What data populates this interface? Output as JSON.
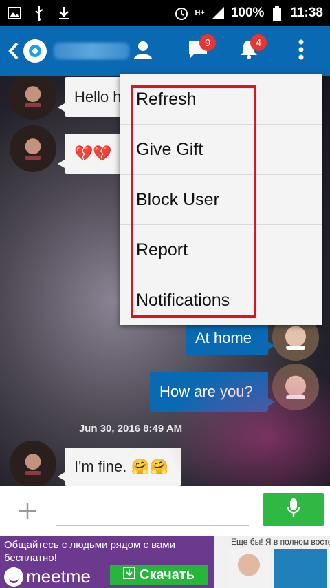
{
  "status_bar": {
    "network": "H+",
    "battery": "100%",
    "time": "11:38"
  },
  "app_bar": {
    "icons": [
      "back-arrow-icon",
      "app-logo-icon",
      "profile-icon",
      "chat-icon",
      "bell-icon",
      "overflow-menu-icon"
    ],
    "chat_badge": "9",
    "notification_badge": "4"
  },
  "messages": {
    "m1": "Hello h",
    "m2": "💔💔",
    "m3": "At home",
    "m4": "How are you?",
    "date": "Jun 30, 2016 8:49 AM",
    "m5": "I'm fine. 🤗🤗"
  },
  "menu": {
    "items": [
      "Refresh",
      "Give Gift",
      "Block User",
      "Report",
      "Notifications"
    ]
  },
  "input": {
    "placeholder": ""
  },
  "ad": {
    "text": "Общайтесь с людьми рядом с вами бесплатно!",
    "brand": "meetme",
    "download": "Скачать",
    "photo_text": "Еще бы! Я в полном восто"
  },
  "colors": {
    "app_bar": "#0a69b3",
    "badge": "#e8352f",
    "mic_button": "#2eb844",
    "highlight": "#e0121b"
  }
}
